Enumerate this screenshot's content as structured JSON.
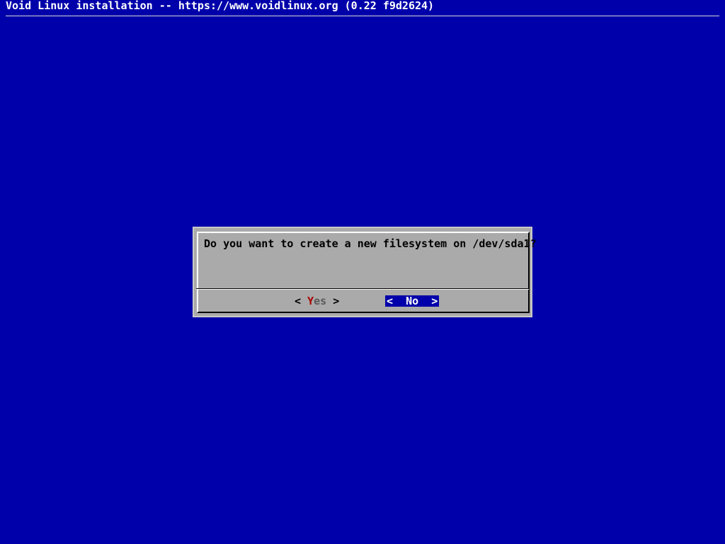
{
  "backtitle": "Void Linux installation -- https://www.voidlinux.org (0.22 f9d2624)",
  "dialog": {
    "message": "Do you want to create a new filesystem on /dev/sda1?",
    "buttons": {
      "yes": {
        "left_bracket": "<",
        "hotkey": "Y",
        "rest": "es",
        "right_bracket": ">"
      },
      "no": {
        "label": "<  No  >"
      }
    },
    "selected_button": "no"
  },
  "colors": {
    "background": "#0000aa",
    "dialog_bg": "#aaaaaa",
    "hotkey": "#aa0000",
    "selected_button_bg": "#0000aa"
  }
}
